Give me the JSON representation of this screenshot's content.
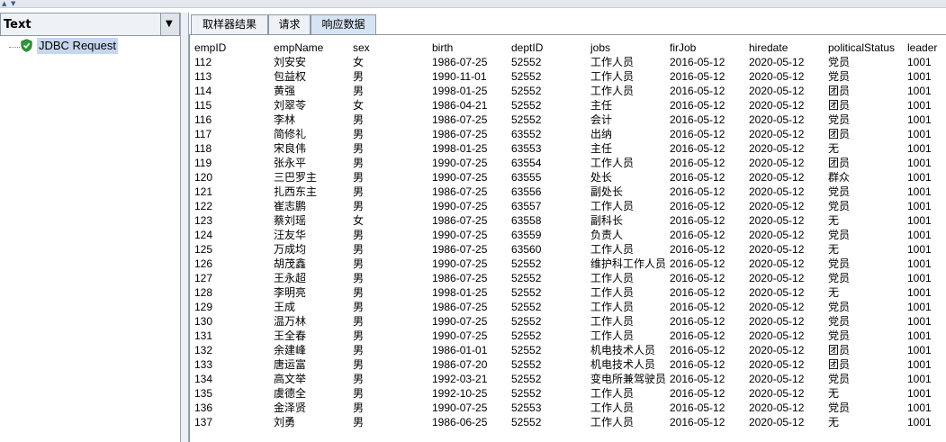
{
  "left_pane": {
    "header_label": "Text",
    "tree": [
      {
        "label": "JDBC Request",
        "icon": "shield-check-icon"
      }
    ]
  },
  "tabs": [
    {
      "label": "取样器结果",
      "active": false
    },
    {
      "label": "请求",
      "active": false
    },
    {
      "label": "响应数据",
      "active": true
    }
  ],
  "response": {
    "headers": [
      "empID",
      "empName",
      "sex",
      "birth",
      "deptID",
      "jobs",
      "firJob",
      "hiredate",
      "politicalStatus",
      "leader"
    ],
    "rows": [
      [
        "112",
        "刘安安",
        "女",
        "1986-07-25",
        "52552",
        "工作人员",
        "2016-05-12",
        "2020-05-12",
        "党员",
        "1001"
      ],
      [
        "113",
        "包益权",
        "男",
        "1990-11-01",
        "52552",
        "工作人员",
        "2016-05-12",
        "2020-05-12",
        "党员",
        "1001"
      ],
      [
        "114",
        "黄强",
        "男",
        "1998-01-25",
        "52552",
        "工作人员",
        "2016-05-12",
        "2020-05-12",
        "团员",
        "1001"
      ],
      [
        "115",
        "刘翠苓",
        "女",
        "1986-04-21",
        "52552",
        "主任",
        "2016-05-12",
        "2020-05-12",
        "团员",
        "1001"
      ],
      [
        "116",
        "李林",
        "男",
        "1986-07-25",
        "52552",
        "会计",
        "2016-05-12",
        "2020-05-12",
        "党员",
        "1001"
      ],
      [
        "117",
        "简修礼",
        "男",
        "1986-07-25",
        "63552",
        "出纳",
        "2016-05-12",
        "2020-05-12",
        "团员",
        "1001"
      ],
      [
        "118",
        "宋良伟",
        "男",
        "1998-01-25",
        "63553",
        "主任",
        "2016-05-12",
        "2020-05-12",
        "无",
        "1001"
      ],
      [
        "119",
        "张永平",
        "男",
        "1990-07-25",
        "63554",
        "工作人员",
        "2016-05-12",
        "2020-05-12",
        "团员",
        "1001"
      ],
      [
        "120",
        "三巴罗主",
        "男",
        "1990-07-25",
        "63555",
        "处长",
        "2016-05-12",
        "2020-05-12",
        "群众",
        "1001"
      ],
      [
        "121",
        "扎西东主",
        "男",
        "1986-07-25",
        "63556",
        "副处长",
        "2016-05-12",
        "2020-05-12",
        "党员",
        "1001"
      ],
      [
        "122",
        "崔志鹏",
        "男",
        "1990-07-25",
        "63557",
        "工作人员",
        "2016-05-12",
        "2020-05-12",
        "党员",
        "1001"
      ],
      [
        "123",
        "蔡刘瑶",
        "女",
        "1986-07-25",
        "63558",
        "副科长",
        "2016-05-12",
        "2020-05-12",
        "无",
        "1001"
      ],
      [
        "124",
        "汪友华",
        "男",
        "1990-07-25",
        "63559",
        "负责人",
        "2016-05-12",
        "2020-05-12",
        "党员",
        "1001"
      ],
      [
        "125",
        "万成均",
        "男",
        "1986-07-25",
        "63560",
        "工作人员",
        "2016-05-12",
        "2020-05-12",
        "无",
        "1001"
      ],
      [
        "126",
        "胡茂鑫",
        "男",
        "1990-07-25",
        "52552",
        "维护科工作人员",
        "2016-05-12",
        "2020-05-12",
        "党员",
        "1001"
      ],
      [
        "127",
        "王永超",
        "男",
        "1986-07-25",
        "52552",
        "工作人员",
        "2016-05-12",
        "2020-05-12",
        "党员",
        "1001"
      ],
      [
        "128",
        "李明亮",
        "男",
        "1998-01-25",
        "52552",
        "工作人员",
        "2016-05-12",
        "2020-05-12",
        "无",
        "1001"
      ],
      [
        "129",
        "王成",
        "男",
        "1986-07-25",
        "52552",
        "工作人员",
        "2016-05-12",
        "2020-05-12",
        "党员",
        "1001"
      ],
      [
        "130",
        "温万林",
        "男",
        "1990-07-25",
        "52552",
        "工作人员",
        "2016-05-12",
        "2020-05-12",
        "党员",
        "1001"
      ],
      [
        "131",
        "王全春",
        "男",
        "1990-07-25",
        "52552",
        "工作人员",
        "2016-05-12",
        "2020-05-12",
        "党员",
        "1001"
      ],
      [
        "132",
        "余建峰",
        "男",
        "1986-01-01",
        "52552",
        "机电技术人员",
        "2016-05-12",
        "2020-05-12",
        "团员",
        "1001"
      ],
      [
        "133",
        "唐运富",
        "男",
        "1986-07-20",
        "52552",
        "机电技术人员",
        "2016-05-12",
        "2020-05-12",
        "团员",
        "1001"
      ],
      [
        "134",
        "高文举",
        "男",
        "1992-03-21",
        "52552",
        "变电所兼驾驶员",
        "2016-05-12",
        "2020-05-12",
        "党员",
        "1001"
      ],
      [
        "135",
        "虞德全",
        "男",
        "1992-10-25",
        "52552",
        "工作人员",
        "2016-05-12",
        "2020-05-12",
        "无",
        "1001"
      ],
      [
        "136",
        "金泽贤",
        "男",
        "1990-07-25",
        "52553",
        "工作人员",
        "2016-05-12",
        "2020-05-12",
        "党员",
        "1001"
      ],
      [
        "137",
        "刘勇",
        "男",
        "1986-06-25",
        "52552",
        "工作人员",
        "2016-05-12",
        "2020-05-12",
        "无",
        "1001"
      ]
    ]
  },
  "colors": {
    "selection": "#c6d8ee",
    "active_tab": "#d6e3f2",
    "shield_green": "#2e9a3a"
  }
}
